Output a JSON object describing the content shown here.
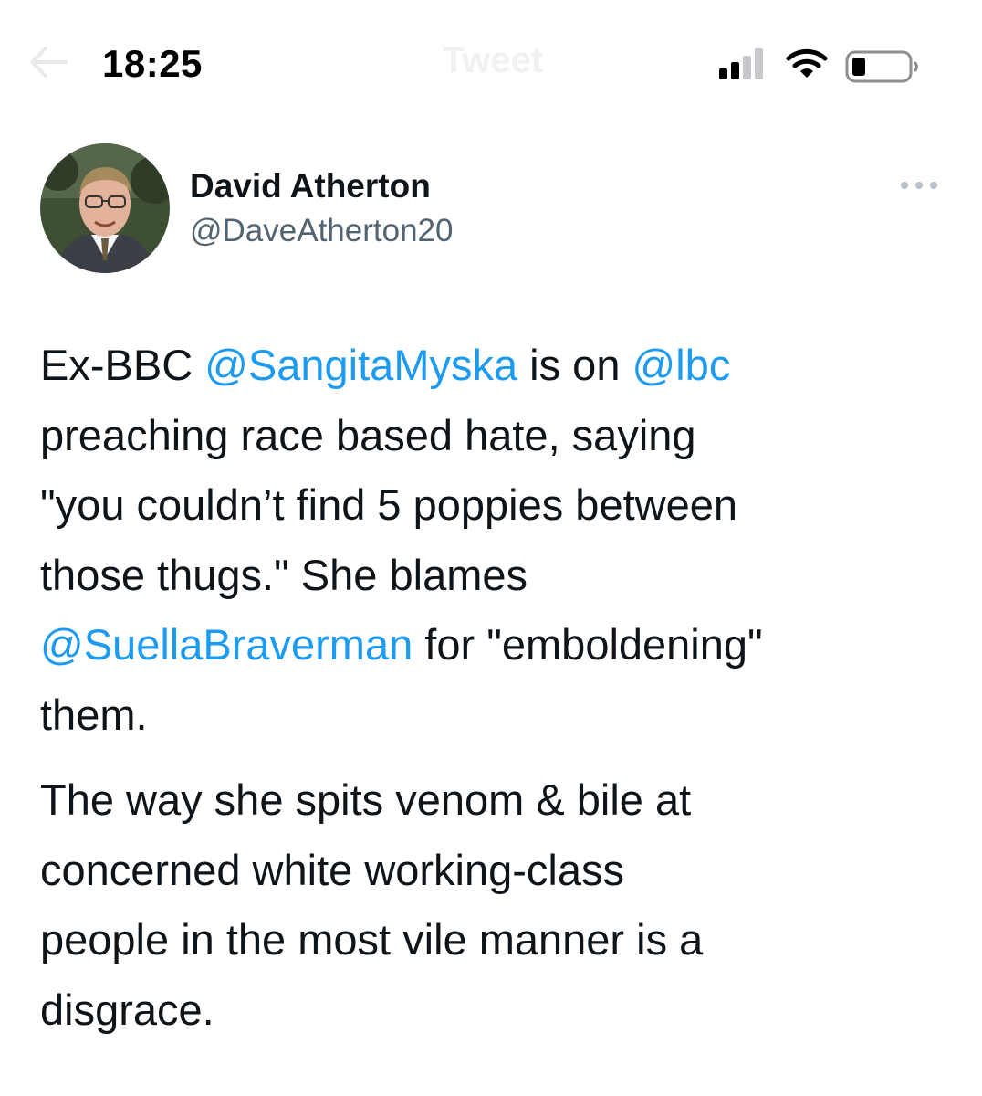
{
  "status_bar": {
    "time": "18:25",
    "header_title": "Tweet",
    "icons": [
      "back-arrow-icon",
      "cellular-signal-icon",
      "wifi-icon",
      "battery-icon"
    ]
  },
  "tweet": {
    "author": {
      "name": "David Atherton",
      "handle": "@DaveAtherton20",
      "avatar_icon": "profile-photo"
    },
    "more_icon": "more-options-icon",
    "paragraph_1": {
      "t1": "Ex-BBC ",
      "mention1": "@SangitaMyska",
      "t2": " is on ",
      "mention2": "@lbc",
      "line2": "preaching race based hate, saying",
      "line3": "\"you couldn’t find 5 poppies between",
      "line4": "those thugs.\" She blames",
      "mention3": "@SuellaBraverman",
      "t3": " for \"emboldening\"",
      "line6": "them."
    },
    "paragraph_2": {
      "line1": "The way she spits venom & bile at",
      "line2": "concerned white working-class",
      "line3": "people in the most vile manner is a",
      "line4": "disgrace."
    }
  },
  "colors": {
    "text": "#0f1419",
    "secondary_text": "#536471",
    "mention": "#1d9bf0",
    "background": "#ffffff"
  }
}
